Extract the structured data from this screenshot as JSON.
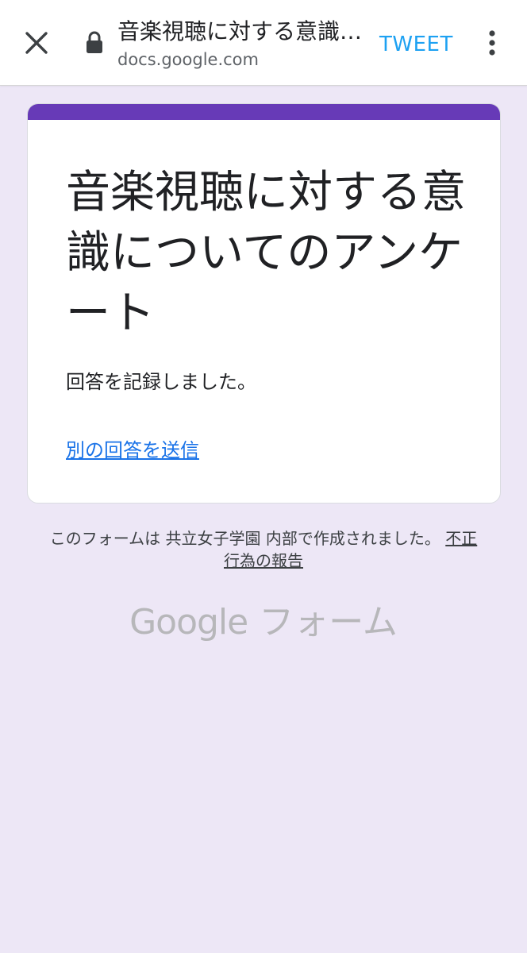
{
  "browser": {
    "title": "音楽視聴に対する意識についてのアンケート",
    "url": "docs.google.com",
    "tweet_label": "TWEET",
    "icons": {
      "close": "close-icon",
      "lock": "lock-icon",
      "menu": "more-vert-icon"
    }
  },
  "form": {
    "title": "音楽視聴に対する意識についてのアンケート",
    "confirmation": "回答を記録しました。",
    "another_response_link": "別の回答を送信",
    "accent_color": "#673ab7"
  },
  "footer": {
    "note_prefix": "このフォームは 共立女子学園 内部で作成されました。",
    "report_link": "不正行為の報告",
    "brand_google": "Google",
    "brand_forms": "フォーム"
  },
  "colors": {
    "page_background": "#ede7f6",
    "tweet": "#1da1f2",
    "link": "#1a73e8"
  }
}
